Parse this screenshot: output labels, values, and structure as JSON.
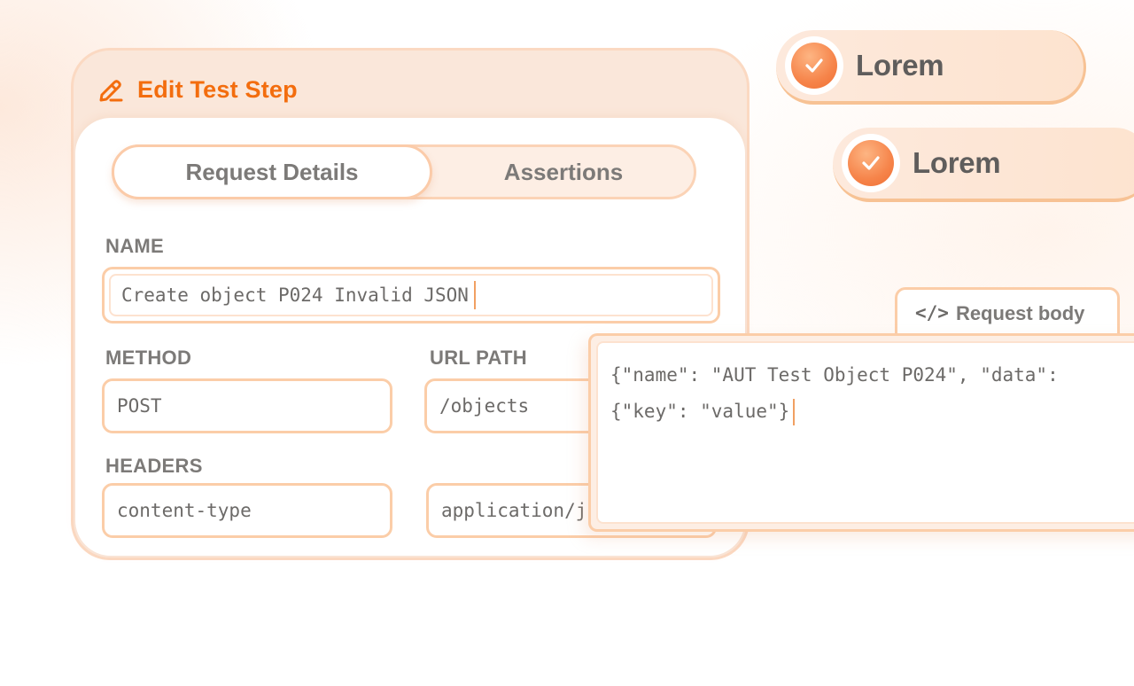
{
  "editor": {
    "title": "Edit Test Step",
    "tabs": [
      {
        "label": "Request Details",
        "active": true
      },
      {
        "label": "Assertions",
        "active": false
      }
    ],
    "name_label": "NAME",
    "name_value": "Create object P024 Invalid JSON",
    "method_label": "METHOD",
    "method_value": "POST",
    "url_label": "URL PATH",
    "url_value": "/objects",
    "headers_label": "HEADERS",
    "header_key": "content-type",
    "header_value": "application/json"
  },
  "badges": [
    {
      "label": "Lorem",
      "icon": "check-icon"
    },
    {
      "label": "Lorem",
      "icon": "check-icon"
    }
  ],
  "request_body": {
    "tab_icon": "</>",
    "tab_label": "Request body",
    "line1": "{\"name\": \"AUT Test Object P024\", \"data\":",
    "line2": "{\"key\": \"value\"}"
  },
  "colors": {
    "accent": "#f36d0e",
    "border": "#fbcda8",
    "text": "#7c7a78"
  }
}
